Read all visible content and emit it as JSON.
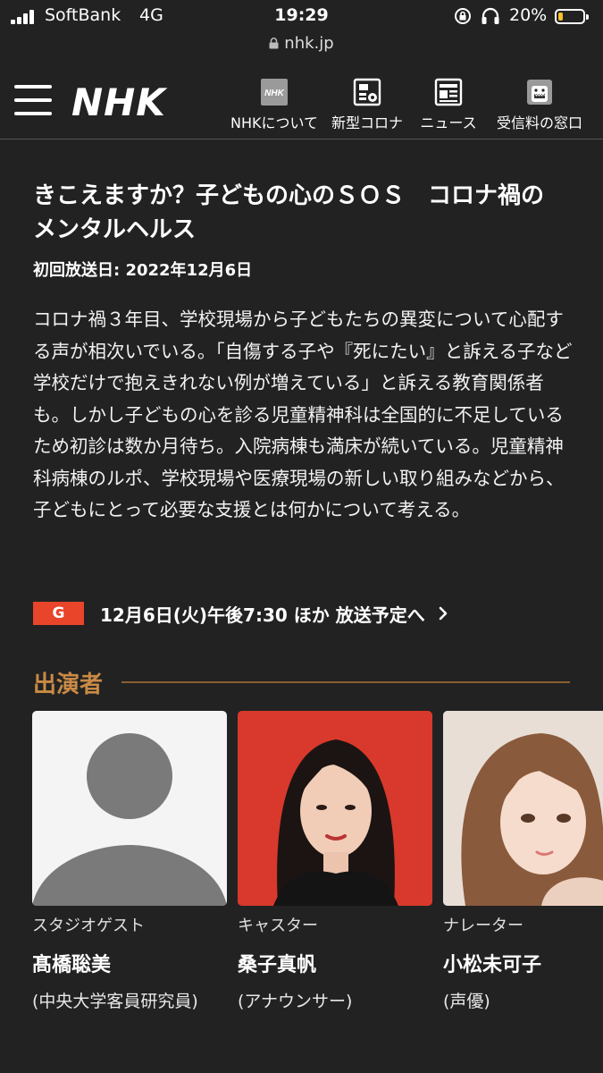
{
  "status_bar": {
    "carrier": "SoftBank",
    "network": "4G",
    "time": "19:29",
    "battery_percent": "20%",
    "battery_level": 0.2,
    "battery_color": "#f4c22b"
  },
  "browser": {
    "url": "nhk.jp"
  },
  "header": {
    "logo": "NHK",
    "nav": [
      {
        "label": "NHKについて",
        "icon": "nhk-icon"
      },
      {
        "label": "新型コロナ",
        "icon": "virus-icon"
      },
      {
        "label": "ニュース",
        "icon": "news-icon"
      },
      {
        "label": "受信料の窓口",
        "icon": "domo-icon"
      }
    ]
  },
  "program": {
    "title_line1": "きこえますか？子どもの心のＳＯＳ　コロナ禍の",
    "title_line2": "メンタルヘルス",
    "first_broadcast": "初回放送日: 2022年12月6日",
    "description": "コロナ禍３年目、学校現場から子どもたちの異変について心配する声が相次いでいる。「自傷する子や『死にたい』と訴える子など学校だけで抱えきれない例が増えている」と訴える教育関係者も。しかし子どもの心を診る児童精神科は全国的に不足しているため初診は数か月待ち。入院病棟も満床が続いている。児童精神科病棟のルポ、学校現場や医療現場の新しい取り組みなどから、子どもにとって必要な支援とは何かについて考える。",
    "channel": "G",
    "channel_color": "#e8452a",
    "schedule": "12月6日(火)午後7:30 ほか 放送予定へ"
  },
  "cast": {
    "heading": "出演者",
    "members": [
      {
        "role": "スタジオゲスト",
        "name": "髙橋聡美",
        "affiliation": "(中央大学客員研究員)"
      },
      {
        "role": "キャスター",
        "name": "桑子真帆",
        "affiliation": "(アナウンサー)"
      },
      {
        "role": "ナレーター",
        "name": "小松未可子",
        "affiliation": "(声優)"
      }
    ]
  }
}
